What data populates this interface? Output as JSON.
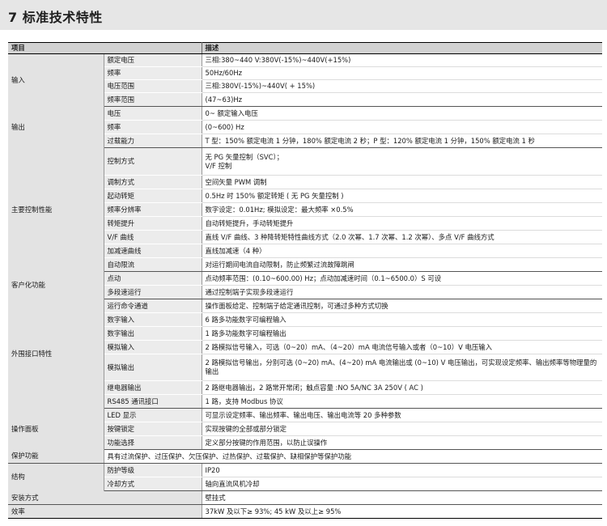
{
  "section": {
    "title": "7 标准技术特性"
  },
  "table": {
    "headers": {
      "category": "项目",
      "description": "描述"
    },
    "rows": [
      {
        "category": "输入",
        "item": "额定电压",
        "desc": "三相:380~440 V:380V(-15%)~440V(+15%)"
      },
      {
        "item": "频率",
        "desc": "50Hz/60Hz"
      },
      {
        "item": "电压范围",
        "desc": "三相:380V(-15%)~440V( + 15%)"
      },
      {
        "item": "频率范围",
        "desc": "(47~63)Hz"
      },
      {
        "category": "输出",
        "item": "电压",
        "desc": "0~ 额定输入电压"
      },
      {
        "item": "频率",
        "desc": "(0~600) Hz"
      },
      {
        "item": "过载能力",
        "desc": "T 型：150% 额定电流 1 分钟，180% 额定电流 2 秒；P 型：120% 额定电流 1 分钟，150% 额定电流 1 秒"
      },
      {
        "category": "主要控制性能",
        "item": "控制方式",
        "desc": "无 PG 矢量控制（SVC）；",
        "desc2": "V/F 控制"
      },
      {
        "item": "调制方式",
        "desc": "空间矢量 PWM 调制"
      },
      {
        "item": "起动转矩",
        "desc": "0.5Hz 时 150% 额定转矩 ( 无 PG 矢量控制 )"
      },
      {
        "item": "频率分辨率",
        "desc": "数字设定：0.01Hz; 模拟设定：最大频率 ×0.5%"
      },
      {
        "item": "转矩提升",
        "desc": "自动转矩提升，手动转矩提升"
      },
      {
        "item": "V/F 曲线",
        "desc": "直线 V/F 曲线、3 种降转矩特性曲线方式（2.0 次幂、1.7 次幂、1.2 次幂）、多点 V/F 曲线方式"
      },
      {
        "item": "加减速曲线",
        "desc": "直线加减速（4 种）"
      },
      {
        "item": "自动限流",
        "desc": "对运行期间电流自动限制，防止频繁过流故障跳闸"
      },
      {
        "category": "客户化功能",
        "item": "点动",
        "desc": "点动频率范围：(0.10~600.00) Hz；点动加减速时间（0.1~6500.0）S 可设"
      },
      {
        "item": "多段速运行",
        "desc": "通过控制端子实现多段速运行"
      },
      {
        "category": "外围接口特性",
        "item": "运行命令通道",
        "desc": "操作面板给定、控制端子给定通讯控制，可通过多种方式切换"
      },
      {
        "item": "数字输入",
        "desc": "6 路多功能数字可编程输入"
      },
      {
        "item": "数字输出",
        "desc": "1 路多功能数字可编程输出"
      },
      {
        "item": "模拟输入",
        "desc": "2 路模拟信号输入，可选（0~20）mA、（4~20）mA 电流信号输入或者（0~10）V 电压输入"
      },
      {
        "item": "模拟输出",
        "desc": "2 路模拟信号输出，分别可选 (0~20) mA、(4~20) mA 电流输出或 (0~10) V 电压输出，可实现设定频率、输出频率等物理量的输出"
      },
      {
        "item": "继电器输出",
        "desc": "2 路继电器输出，2 路常开常闭；触点容量 :NO 5A/NC 3A 250V ( AC )"
      },
      {
        "item": "RS485 通讯接口",
        "desc": "1 路，支持 Modbus 协议"
      },
      {
        "category": "操作面板",
        "item": "LED 显示",
        "desc": "可显示设定频率、输出频率、输出电压、输出电流等 20 多种参数"
      },
      {
        "item": "按键锁定",
        "desc": "实现按键的全部或部分锁定"
      },
      {
        "item": "功能选择",
        "desc": "定义部分按键的作用范围，以防止误操作"
      },
      {
        "category": "保护功能",
        "desc": "具有过流保护、过压保护、欠压保护、过热保护、过载保护、缺相保护等保护功能"
      },
      {
        "category": "结构",
        "item": "防护等级",
        "desc": "IP20"
      },
      {
        "item": "冷却方式",
        "desc": "轴向直流风机冷却"
      },
      {
        "category": "安装方式",
        "desc": "壁挂式"
      },
      {
        "category": "效率",
        "desc": "37kW 及以下≥ 93%; 45 kW 及以上≥ 95%"
      }
    ]
  }
}
